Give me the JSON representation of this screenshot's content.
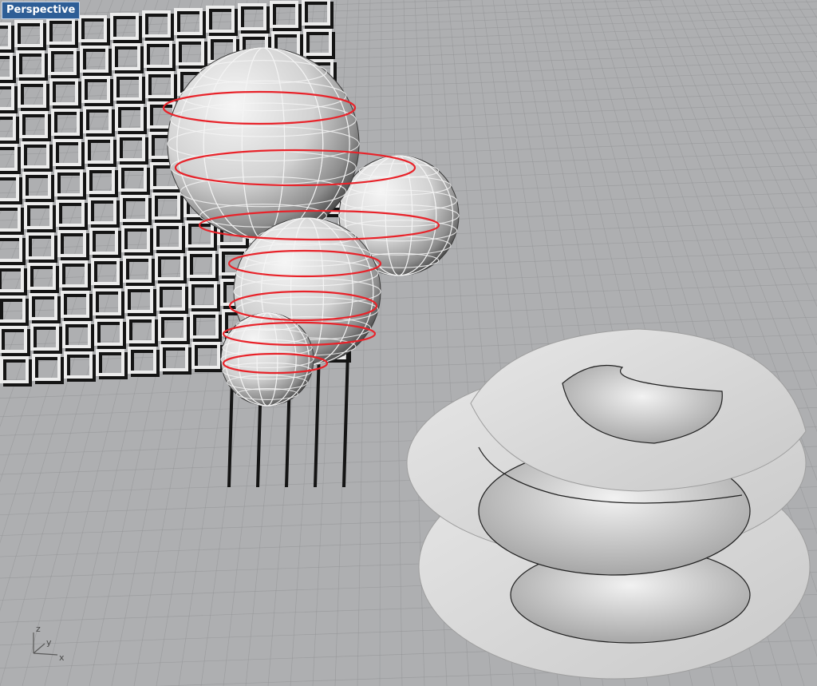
{
  "viewport": {
    "title": "Perspective"
  },
  "axes": {
    "z_label": "z",
    "y_label": "y",
    "x_label": "x"
  },
  "colors": {
    "grid_bg": "#aeafb1",
    "grid_line": "#8f9092",
    "lattice_light": "#ececec",
    "lattice_dark": "#141414",
    "sphere_face": "#d8d8d8",
    "sphere_edge": "#f5f5f5",
    "helix_curve": "#e8232a",
    "ribbon_face": "#d9d9d9",
    "viewport_label_bg": "#2e5e96"
  },
  "scene_objects": [
    "grid-plane",
    "box-lattice",
    "sphere-cluster",
    "helix-curve",
    "spiral-ribbon",
    "axis-triad"
  ]
}
